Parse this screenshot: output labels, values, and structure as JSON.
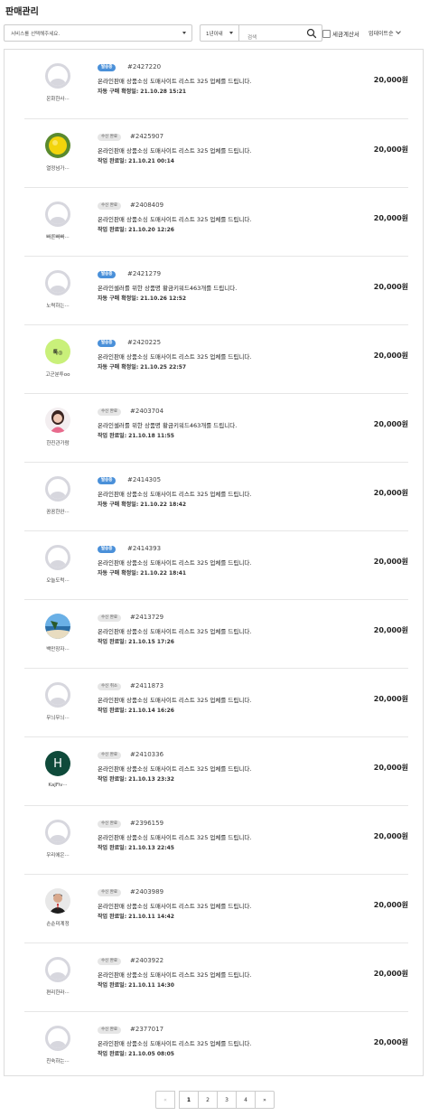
{
  "header": {
    "title": "판매관리"
  },
  "filters": {
    "service_placeholder": "서비스를 선택해주세요.",
    "period_label": "1년이내",
    "search_placeholder": "검색",
    "tax_label": "세금계산서",
    "sort_label": "업데이트순"
  },
  "orders": [
    {
      "seller": "온화한사···",
      "avatar": "default",
      "status": "발송중",
      "status_type": "sending",
      "order_no": "#2427220",
      "title": "온라인판매 상품소싱 도매사이트 리스트 325 업체를 드립니다.",
      "date_label": "자동 구매 확정일: 21.10.28 15:21",
      "price": "20,000원"
    },
    {
      "seller": "열정넘가···",
      "avatar": "lemon",
      "status": "수신 완료",
      "status_type": "done",
      "order_no": "#2425907",
      "title": "온라인판매 상품소싱 도매사이트 리스트 325 업체를 드립니다.",
      "date_label": "작업 완료일: 21.10.21 00:14",
      "price": "20,000원"
    },
    {
      "seller": "빠른빠빠···",
      "avatar": "default",
      "status": "수신 완료",
      "status_type": "done",
      "order_no": "#2408409",
      "title": "온라인판매 상품소싱 도매사이트 리스트 325 업체를 드립니다.",
      "date_label": "작업 완료일: 21.10.20 12:26",
      "price": "20,000원"
    },
    {
      "seller": "노력하는···",
      "avatar": "default",
      "status": "발송중",
      "status_type": "sending",
      "order_no": "#2421279",
      "title": "온라인셀러를 위한 상품명 황금키워드463개를 드립니다.",
      "date_label": "자동 구매 확정일: 21.10.26 12:52",
      "price": "20,000원"
    },
    {
      "seller": "고군분투oo",
      "avatar": "green",
      "avatar_text": "톡◎",
      "status": "발송중",
      "status_type": "sending",
      "order_no": "#2420225",
      "title": "온라인판매 상품소싱 도매사이트 리스트 325 업체를 드립니다.",
      "date_label": "자동 구매 확정일: 21.10.25 22:57",
      "price": "20,000원"
    },
    {
      "seller": "한진관가람",
      "avatar": "person-woman",
      "status": "수신 완료",
      "status_type": "done",
      "order_no": "#2403704",
      "title": "온라인셀러를 위한 상품명 황금키워드463개를 드립니다.",
      "date_label": "작업 완료일: 21.10.18 11:55",
      "price": "20,000원"
    },
    {
      "seller": "꼼꼼한완···",
      "avatar": "default",
      "status": "발송중",
      "status_type": "sending",
      "order_no": "#2414305",
      "title": "온라인판매 상품소싱 도매사이트 리스트 325 업체를 드립니다.",
      "date_label": "자동 구매 확정일: 21.10.22 18:42",
      "price": "20,000원"
    },
    {
      "seller": "오늘도럭···",
      "avatar": "default",
      "status": "발송중",
      "status_type": "sending",
      "order_no": "#2414393",
      "title": "온라인판매 상품소싱 도매사이트 리스트 325 업체를 드립니다.",
      "date_label": "자동 구매 확정일: 21.10.22 18:41",
      "price": "20,000원"
    },
    {
      "seller": "백만장자···",
      "avatar": "beach",
      "status": "수신 완료",
      "status_type": "done",
      "order_no": "#2413729",
      "title": "온라인판매 상품소싱 도매사이트 리스트 325 업체를 드립니다.",
      "date_label": "작업 완료일: 21.10.15 17:26",
      "price": "20,000원"
    },
    {
      "seller": "무늬무늬···",
      "avatar": "default",
      "status": "수신 취소",
      "status_type": "done",
      "order_no": "#2411873",
      "title": "온라인판매 상품소싱 도매사이트 리스트 325 업체를 드립니다.",
      "date_label": "작업 완료일: 21.10.14 16:26",
      "price": "20,000원"
    },
    {
      "seller": "KaJFiv···",
      "avatar": "letter-h",
      "avatar_text": "H",
      "status": "수신 완료",
      "status_type": "done",
      "order_no": "#2410336",
      "title": "온라인판매 상품소싱 도매사이트 리스트 325 업체를 드립니다.",
      "date_label": "작업 완료일: 21.10.13 23:32",
      "price": "20,000원"
    },
    {
      "seller": "우리에은···",
      "avatar": "default",
      "status": "수신 완료",
      "status_type": "done",
      "order_no": "#2396159",
      "title": "온라인판매 상품소싱 도매사이트 리스트 325 업체를 드립니다.",
      "date_label": "작업 완료일: 21.10.13 22:45",
      "price": "20,000원"
    },
    {
      "seller": "손순미계정",
      "avatar": "person-man",
      "status": "수신 완료",
      "status_type": "done",
      "order_no": "#2403989",
      "title": "온라인판매 상품소싱 도매사이트 리스트 325 업체를 드립니다.",
      "date_label": "작업 완료일: 21.10.11 14:42",
      "price": "20,000원"
    },
    {
      "seller": "편리한라···",
      "avatar": "default",
      "status": "수신 완료",
      "status_type": "done",
      "order_no": "#2403922",
      "title": "온라인판매 상품소싱 도매사이트 리스트 325 업체를 드립니다.",
      "date_label": "작업 완료일: 21.10.11 14:30",
      "price": "20,000원"
    },
    {
      "seller": "친숙하는···",
      "avatar": "default",
      "status": "수신 완료",
      "status_type": "done",
      "order_no": "#2377017",
      "title": "온라인판매 상품소싱 도매사이트 리스트 325 업체를 드립니다.",
      "date_label": "작업 완료일: 21.10.05 08:05",
      "price": "20,000원"
    }
  ],
  "pagination": {
    "prev_label": "«",
    "pages": [
      "1",
      "2",
      "3",
      "4"
    ],
    "next_label": "»",
    "current": "1"
  },
  "colors": {
    "badge_sending": "#4a90d9",
    "badge_done": "#e6e6e6",
    "avatar_default": "#d7d7de"
  }
}
